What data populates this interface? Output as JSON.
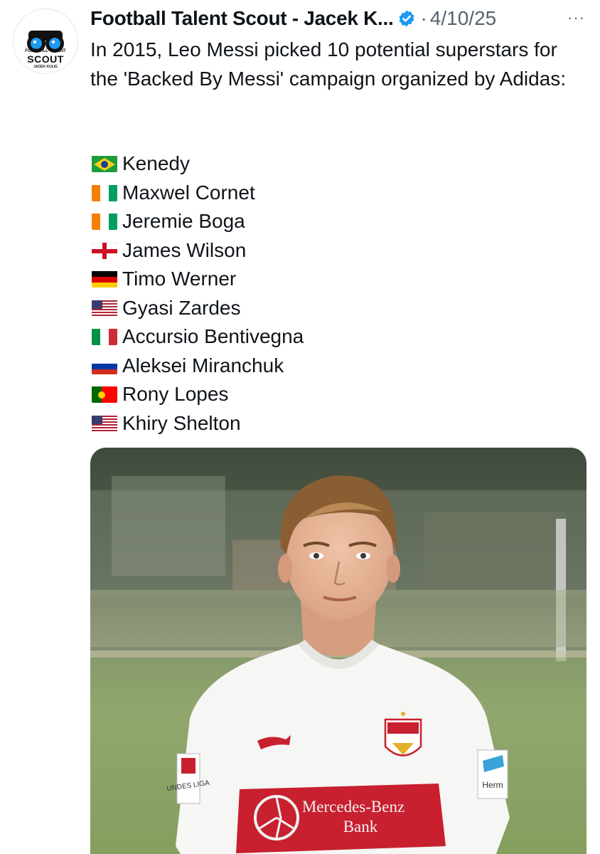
{
  "tweet": {
    "author": "Football Talent Scout - Jacek K...",
    "date": "4/10/25",
    "separator": "·",
    "more": "···",
    "text": "In 2015, Leo Messi picked 10 potential superstars for the 'Backed By Messi' campaign organized by Adidas:",
    "players": [
      {
        "name": "Kenedy",
        "flag": "brazil-flag-icon"
      },
      {
        "name": "Maxwel Cornet",
        "flag": "ivory-coast-flag-icon"
      },
      {
        "name": "Jeremie Boga",
        "flag": "ivory-coast-flag-icon"
      },
      {
        "name": "James Wilson",
        "flag": "england-flag-icon"
      },
      {
        "name": "Timo Werner",
        "flag": "germany-flag-icon"
      },
      {
        "name": "Gyasi Zardes",
        "flag": "usa-flag-icon"
      },
      {
        "name": "Accursio Bentivegna",
        "flag": "italy-flag-icon"
      },
      {
        "name": "Aleksei Miranchuk",
        "flag": "russia-flag-icon"
      },
      {
        "name": "Rony Lopes",
        "flag": "portugal-flag-icon"
      },
      {
        "name": "Khiry Shelton",
        "flag": "usa-flag-icon"
      }
    ]
  },
  "avatar": {
    "logo_top": "FOOTBALL TALENT",
    "logo_main": "SCOUT",
    "logo_sub": "JACEK KULIG"
  },
  "photo": {
    "shirt_sponsor_line1": "Mercedes-Benz",
    "shirt_sponsor_line2": "Bank",
    "sleeve_left": "UNDES LIGA",
    "sleeve_right": "Herm"
  },
  "colors": {
    "verified": "#1d9bf0",
    "muted": "#536471",
    "shirt_red": "#c8202f"
  }
}
